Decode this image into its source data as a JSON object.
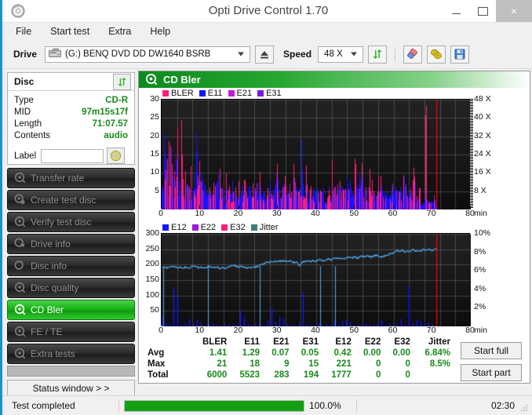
{
  "window": {
    "title": "Opti Drive Control 1.70",
    "icon": "disc-icon",
    "minimize_label": "Minimize",
    "maximize_label": "Maximize",
    "close_label": "×"
  },
  "menu": {
    "items": [
      {
        "label": "File",
        "name": "menu-file"
      },
      {
        "label": "Start test",
        "name": "menu-start-test"
      },
      {
        "label": "Extra",
        "name": "menu-extra"
      },
      {
        "label": "Help",
        "name": "menu-help"
      }
    ]
  },
  "toolbar": {
    "drive_label": "Drive",
    "drive_value": "(G:)   BENQ DVD DD DW1640 BSRB",
    "eject_icon": "eject-icon",
    "speed_label": "Speed",
    "speed_value": "48 X",
    "refresh_icon": "refresh-icon",
    "eraser_icon": "eraser-icon",
    "coins_icon": "coins-icon",
    "save_icon": "save-floppy-icon"
  },
  "disc_panel": {
    "header": "Disc",
    "refresh_icon": "refresh-icon",
    "rows": [
      {
        "key": "Type",
        "value": "CD-R"
      },
      {
        "key": "MID",
        "value": "97m15s17f"
      },
      {
        "key": "Length",
        "value": "71:07.57"
      },
      {
        "key": "Contents",
        "value": "audio"
      }
    ],
    "label_key": "Label",
    "label_value": "",
    "label_placeholder": "",
    "label_button_icon": "cd-disc-icon"
  },
  "nav": {
    "items": [
      {
        "label": "Transfer rate",
        "name": "sidebar-item-transfer-rate",
        "active": false
      },
      {
        "label": "Create test disc",
        "name": "sidebar-item-create-test-disc",
        "active": false
      },
      {
        "label": "Verify test disc",
        "name": "sidebar-item-verify-test-disc",
        "active": false
      },
      {
        "label": "Drive info",
        "name": "sidebar-item-drive-info",
        "active": false
      },
      {
        "label": "Disc info",
        "name": "sidebar-item-disc-info",
        "active": false
      },
      {
        "label": "Disc quality",
        "name": "sidebar-item-disc-quality",
        "active": false
      },
      {
        "label": "CD Bler",
        "name": "sidebar-item-cd-bler",
        "active": true
      },
      {
        "label": "FE / TE",
        "name": "sidebar-item-fe-te",
        "active": false
      },
      {
        "label": "Extra tests",
        "name": "sidebar-item-extra-tests",
        "active": false
      }
    ],
    "status_window_label": "Status window > >"
  },
  "panel": {
    "banner_title": "CD Bler",
    "banner_icon": "disc-scan-icon"
  },
  "buttons": {
    "start_full": "Start full",
    "start_part": "Start part"
  },
  "statusbar": {
    "message": "Test completed",
    "percent_label": "100.0%",
    "percent_value": 100,
    "elapsed": "02:30",
    "progress_color": "#12a012"
  },
  "stats": {
    "columns": [
      "BLER",
      "E11",
      "E21",
      "E31",
      "E12",
      "E22",
      "E32",
      "Jitter"
    ],
    "rows": [
      {
        "label": "Avg",
        "values": [
          "1.41",
          "1.29",
          "0.07",
          "0.05",
          "0.42",
          "0.00",
          "0.00",
          "6.84%"
        ]
      },
      {
        "label": "Max",
        "values": [
          "21",
          "18",
          "9",
          "15",
          "221",
          "0",
          "0",
          "8.5%"
        ]
      },
      {
        "label": "Total",
        "values": [
          "6000",
          "5523",
          "283",
          "194",
          "1777",
          "0",
          "0",
          ""
        ]
      }
    ]
  },
  "chart_data": [
    {
      "type": "line",
      "name": "bler-chart",
      "title": "",
      "xlabel": "min",
      "ylabel": "",
      "xlim": [
        0,
        80
      ],
      "ylim": [
        0,
        30
      ],
      "xticks": [
        0,
        10,
        20,
        30,
        40,
        50,
        60,
        70,
        80
      ],
      "yticks": [
        5,
        10,
        15,
        20,
        25,
        30
      ],
      "y2ticks": [
        "8 X",
        "16 X",
        "24 X",
        "32 X",
        "40 X",
        "48 X"
      ],
      "y2lim": [
        0,
        48
      ],
      "grid": true,
      "legend_position": "top-left",
      "legend": [
        {
          "name": "BLER",
          "color": "#ff1f7a"
        },
        {
          "name": "E11",
          "color": "#1414ff"
        },
        {
          "name": "E21",
          "color": "#c21ad6"
        },
        {
          "name": "E31",
          "color": "#7a1ad6"
        }
      ],
      "series": [
        {
          "name": "BLER",
          "color": "#ff1f7a",
          "values": [
            17,
            9,
            12,
            19,
            15,
            14,
            21,
            13,
            21,
            10,
            9,
            8,
            14,
            6,
            10,
            8,
            11,
            11,
            14,
            7,
            6,
            5,
            9,
            7,
            8,
            10,
            5,
            6,
            9,
            7,
            6,
            5,
            7,
            9,
            5,
            6,
            7,
            5,
            4,
            6,
            5,
            7,
            14,
            5,
            6,
            5,
            8,
            7,
            6,
            9,
            11,
            7,
            6,
            12,
            6,
            5,
            7,
            11,
            7,
            5,
            9,
            6,
            5,
            13,
            7,
            6,
            5,
            8,
            6,
            11,
            7,
            4,
            5,
            6,
            17,
            6,
            5,
            9,
            6,
            5,
            6,
            8,
            7,
            5,
            12,
            13,
            9,
            11,
            7,
            6,
            10,
            9,
            6,
            7,
            8,
            9,
            5,
            6,
            4,
            5,
            6,
            9,
            7,
            5,
            6,
            11,
            9,
            12,
            6,
            7,
            12,
            6,
            5,
            4,
            6,
            30,
            3,
            2,
            2,
            2
          ]
        },
        {
          "name": "E11",
          "color": "#1414ff",
          "values": [
            7,
            16,
            9,
            11,
            13,
            8,
            12,
            9,
            8,
            7,
            6,
            5,
            6,
            6,
            9,
            18,
            10,
            9,
            7,
            6,
            5,
            6,
            7,
            6,
            8,
            5,
            6,
            4,
            5,
            6,
            7,
            5,
            4,
            5,
            6,
            7,
            5,
            4,
            5,
            6,
            5,
            4,
            6,
            5,
            4,
            5,
            6,
            7,
            5,
            6,
            8,
            5,
            4,
            6,
            5,
            4,
            5,
            6,
            5,
            4,
            5,
            16,
            6,
            5,
            4,
            5,
            6,
            5,
            4,
            5,
            6,
            5,
            4,
            5,
            6,
            5,
            4,
            5,
            6,
            5,
            9,
            6,
            7,
            5,
            4,
            6,
            8,
            7,
            5,
            6,
            5,
            4,
            5,
            6,
            5,
            4,
            6,
            5,
            8,
            6,
            5,
            4,
            5,
            6,
            5,
            8,
            6,
            5,
            4,
            5,
            6,
            4,
            3,
            2,
            2,
            2,
            2,
            2,
            2,
            2
          ]
        }
      ],
      "end_marker": {
        "x": 71.1,
        "color": "#ff0000"
      }
    },
    {
      "type": "line",
      "name": "jitter-chart",
      "title": "",
      "xlabel": "min",
      "ylabel": "",
      "xlim": [
        0,
        80
      ],
      "ylim": [
        0,
        300
      ],
      "xticks": [
        0,
        10,
        20,
        30,
        40,
        50,
        60,
        70,
        80
      ],
      "yticks": [
        50,
        100,
        150,
        200,
        250,
        300
      ],
      "y2ticks": [
        "2%",
        "4%",
        "6%",
        "8%",
        "10%"
      ],
      "y2lim": [
        0,
        10
      ],
      "grid": true,
      "legend_position": "top-left",
      "legend": [
        {
          "name": "E12",
          "color": "#1414ff"
        },
        {
          "name": "E22",
          "color": "#9b1ad6"
        },
        {
          "name": "E32",
          "color": "#ff1f7a"
        },
        {
          "name": "Jitter",
          "color": "#3d7d7d"
        }
      ],
      "series": [
        {
          "name": "Jitter",
          "color": "#4da6e8",
          "unit": "%",
          "values": [
            6.3,
            6.4,
            6.3,
            6.4,
            6.5,
            6.4,
            6.3,
            6.4,
            6.3,
            6.4,
            6.3,
            6.4,
            6.5,
            6.4,
            6.3,
            6.4,
            6.3,
            6.4,
            6.5,
            6.4,
            6.3,
            6.4,
            6.3,
            6.4,
            6.3,
            6.4,
            6.5,
            6.6,
            6.5,
            6.4,
            6.5,
            6.4,
            6.3,
            6.4,
            6.3,
            6.4,
            6.5,
            6.6,
            6.7,
            6.8,
            6.9,
            7.0,
            6.9,
            7.0,
            7.1,
            7.0,
            7.1,
            7.0,
            7.1,
            7.0,
            6.9,
            7.0,
            6.5,
            6.9,
            7.0,
            7.1,
            7.0,
            7.1,
            7.0,
            7.1,
            7.2,
            7.1,
            7.2,
            7.3,
            7.2,
            7.3,
            7.4,
            7.3,
            7.4,
            7.3,
            7.4,
            7.5,
            7.4,
            7.5,
            7.4,
            7.5,
            7.6,
            7.5,
            7.6,
            7.5,
            7.6,
            7.7,
            7.6,
            7.5,
            7.6,
            7.7,
            7.8,
            7.9,
            8.0,
            8.2,
            8.1,
            8.3,
            8.0,
            8.2,
            8.1,
            8.3,
            8.2,
            8.1,
            8.2,
            8.3,
            8.2,
            8.3,
            8.2,
            8.3,
            8.4
          ]
        },
        {
          "name": "E12",
          "color": "#1414ff",
          "values": [
            30,
            12,
            8,
            124,
            99,
            6,
            10,
            25,
            8,
            22,
            10,
            4,
            5,
            8,
            6,
            4,
            10,
            5,
            4,
            8,
            52,
            30,
            6,
            4,
            8,
            6,
            4,
            20,
            62,
            12,
            30,
            25,
            8,
            4,
            6,
            10,
            112,
            8,
            6,
            4,
            10,
            6,
            8,
            4,
            20,
            6,
            18,
            22,
            14,
            6,
            4,
            8,
            10,
            4,
            6,
            8,
            22,
            4,
            10,
            6,
            8,
            24,
            6,
            130,
            10,
            22,
            18,
            8,
            12,
            6,
            4
          ]
        }
      ],
      "end_marker": {
        "x": 71.1,
        "color": "#ff0000"
      }
    }
  ]
}
